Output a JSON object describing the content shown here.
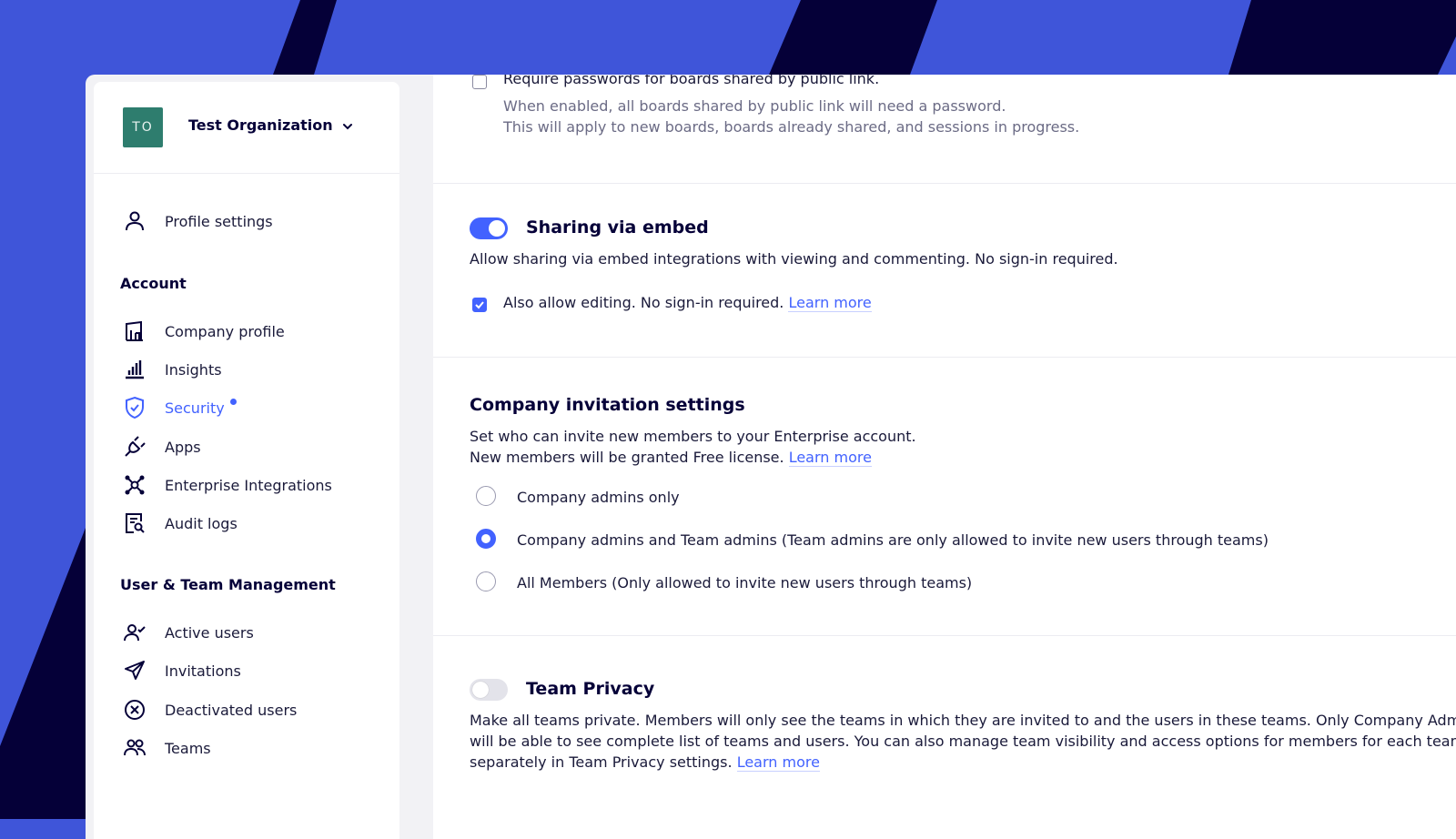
{
  "colors": {
    "brand_blue": "#3f55d9",
    "navy": "#050038",
    "accent": "#4262ff",
    "avatar_green": "#2e7d6e"
  },
  "organization": {
    "initials": "TO",
    "name": "Test Organization",
    "chevron_icon": "chevron-down-icon"
  },
  "sidebar": {
    "profile": {
      "label": "Profile settings",
      "icon": "user-icon"
    },
    "account_heading": "Account",
    "account_items": [
      {
        "label": "Company profile",
        "icon": "building-icon"
      },
      {
        "label": "Insights",
        "icon": "bar-chart-icon"
      },
      {
        "label": "Security",
        "icon": "shield-check-icon",
        "active": true,
        "badge": "dot"
      },
      {
        "label": "Apps",
        "icon": "plug-icon"
      },
      {
        "label": "Enterprise Integrations",
        "icon": "integrations-icon"
      },
      {
        "label": "Audit logs",
        "icon": "audit-log-icon"
      }
    ],
    "team_heading": "User & Team Management",
    "team_items": [
      {
        "label": "Active users",
        "icon": "user-check-icon"
      },
      {
        "label": "Invitations",
        "icon": "paper-plane-icon"
      },
      {
        "label": "Deactivated users",
        "icon": "x-circle-icon"
      },
      {
        "label": "Teams",
        "icon": "users-icon"
      }
    ]
  },
  "content": {
    "password_setting": {
      "label": "Require passwords for boards shared by public link.",
      "checked": false,
      "description_1": "When enabled, all boards shared by public link will need a password.",
      "description_2": "This will apply to new boards, boards already shared, and sessions in progress."
    },
    "embed": {
      "title": "Sharing via embed",
      "enabled": true,
      "description": "Allow sharing via embed integrations with viewing and commenting. No sign-in required.",
      "editing_label": "Also allow editing. No sign-in required.",
      "editing_checked": true,
      "learn_more": "Learn more"
    },
    "invitation": {
      "title": "Company invitation settings",
      "description_1": "Set who can invite new members to your Enterprise account.",
      "description_2": "New members will be granted Free license.",
      "learn_more": "Learn more",
      "options": [
        {
          "label": "Company admins only",
          "selected": false
        },
        {
          "label": "Company admins and Team admins (Team admins are only allowed to invite new users through teams)",
          "selected": true
        },
        {
          "label": "All Members (Only allowed to invite new users through teams)",
          "selected": false
        }
      ]
    },
    "team_privacy": {
      "title": "Team Privacy",
      "enabled": false,
      "description_line_1": "Make all teams private. Members will only see the teams in which they are invited to and the users in these teams. Only Company Admins",
      "description_line_2": "will be able to see complete list of teams and users. You can also manage team visibility and access options for members for each team",
      "description_line_3": "separately in Team Privacy settings.",
      "learn_more": "Learn more"
    }
  }
}
